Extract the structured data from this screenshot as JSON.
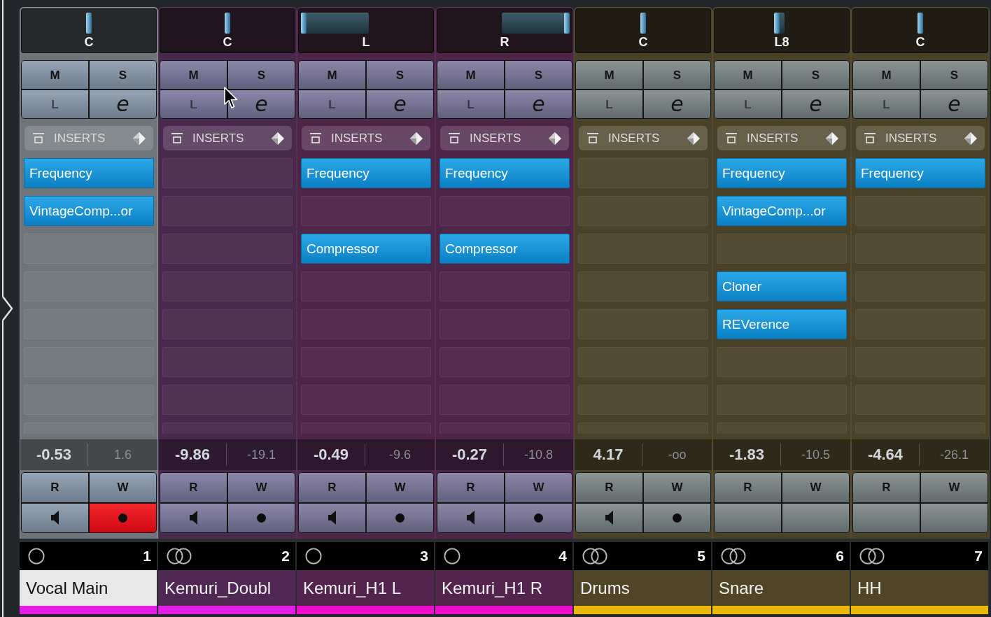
{
  "channels": [
    {
      "pan": {
        "label": "C",
        "level": 0.5
      },
      "buttons": [
        {
          "kind": "text",
          "label": "M",
          "disabled": false
        },
        {
          "kind": "text",
          "label": "S",
          "disabled": false
        },
        {
          "kind": "text",
          "label": "L",
          "disabled": true
        },
        {
          "kind": "edit",
          "label": "e",
          "disabled": false
        }
      ],
      "inserts": {
        "title": "INSERTS",
        "slots": [
          {
            "kind": "plugin",
            "name": "Frequency"
          },
          {
            "kind": "plugin",
            "name": "VintageComp...or"
          },
          {
            "kind": "empty"
          },
          {
            "kind": "empty"
          },
          {
            "kind": "empty"
          },
          {
            "kind": "empty"
          },
          {
            "kind": "empty"
          },
          {
            "kind": "empty"
          }
        ]
      },
      "volume": "-0.53",
      "peak": "1.6",
      "automation": [
        {
          "kind": "text",
          "label": "R"
        },
        {
          "kind": "text",
          "label": "W"
        },
        {
          "kind": "monitor",
          "on": false
        },
        {
          "kind": "record",
          "on": true
        }
      ],
      "kind": "mono",
      "number": "1",
      "name": "Vocal Main",
      "selected": true,
      "color": "#e21ee6"
    },
    {
      "pan": {
        "label": "C",
        "level": 0.5
      },
      "buttons": [
        {
          "kind": "text",
          "label": "M",
          "disabled": false
        },
        {
          "kind": "text",
          "label": "S",
          "disabled": false
        },
        {
          "kind": "text",
          "label": "L",
          "disabled": true
        },
        {
          "kind": "edit",
          "label": "e",
          "disabled": false
        }
      ],
      "inserts": {
        "title": "INSERTS",
        "slots": [
          {
            "kind": "empty"
          },
          {
            "kind": "empty"
          },
          {
            "kind": "empty"
          },
          {
            "kind": "empty"
          },
          {
            "kind": "empty"
          },
          {
            "kind": "empty"
          },
          {
            "kind": "empty"
          },
          {
            "kind": "empty"
          }
        ]
      },
      "volume": "-9.86",
      "peak": "-19.1",
      "automation": [
        {
          "kind": "text",
          "label": "R"
        },
        {
          "kind": "text",
          "label": "W"
        },
        {
          "kind": "monitor",
          "on": false
        },
        {
          "kind": "record",
          "on": false
        }
      ],
      "kind": "stereo",
      "number": "2",
      "name": "Kemuri_Doubl",
      "selected": false,
      "color": "#e21ee6"
    },
    {
      "pan": {
        "label": "L",
        "level": 0
      },
      "buttons": [
        {
          "kind": "text",
          "label": "M",
          "disabled": false
        },
        {
          "kind": "text",
          "label": "S",
          "disabled": false
        },
        {
          "kind": "text",
          "label": "L",
          "disabled": true
        },
        {
          "kind": "edit",
          "label": "e",
          "disabled": false
        }
      ],
      "inserts": {
        "title": "INSERTS",
        "slots": [
          {
            "kind": "plugin",
            "name": "Frequency"
          },
          {
            "kind": "empty"
          },
          {
            "kind": "plugin",
            "name": "Compressor"
          },
          {
            "kind": "empty"
          },
          {
            "kind": "empty"
          },
          {
            "kind": "empty"
          },
          {
            "kind": "empty"
          },
          {
            "kind": "empty"
          }
        ]
      },
      "volume": "-0.49",
      "peak": "-9.6",
      "automation": [
        {
          "kind": "text",
          "label": "R"
        },
        {
          "kind": "text",
          "label": "W"
        },
        {
          "kind": "monitor",
          "on": false
        },
        {
          "kind": "record",
          "on": false
        }
      ],
      "kind": "mono",
      "number": "3",
      "name": "Kemuri_H1 L",
      "selected": false,
      "color": "#f00ccc"
    },
    {
      "pan": {
        "label": "R",
        "level": 1
      },
      "buttons": [
        {
          "kind": "text",
          "label": "M",
          "disabled": false
        },
        {
          "kind": "text",
          "label": "S",
          "disabled": false
        },
        {
          "kind": "text",
          "label": "L",
          "disabled": true
        },
        {
          "kind": "edit",
          "label": "e",
          "disabled": false
        }
      ],
      "inserts": {
        "title": "INSERTS",
        "slots": [
          {
            "kind": "plugin",
            "name": "Frequency"
          },
          {
            "kind": "empty"
          },
          {
            "kind": "plugin",
            "name": "Compressor"
          },
          {
            "kind": "empty"
          },
          {
            "kind": "empty"
          },
          {
            "kind": "empty"
          },
          {
            "kind": "empty"
          },
          {
            "kind": "empty"
          }
        ]
      },
      "volume": "-0.27",
      "peak": "-10.8",
      "automation": [
        {
          "kind": "text",
          "label": "R"
        },
        {
          "kind": "text",
          "label": "W"
        },
        {
          "kind": "monitor",
          "on": false
        },
        {
          "kind": "record",
          "on": false
        }
      ],
      "kind": "mono",
      "number": "4",
      "name": "Kemuri_H1 R",
      "selected": false,
      "color": "#f00ccc"
    },
    {
      "pan": {
        "label": "C",
        "level": 0.5
      },
      "buttons": [
        {
          "kind": "text",
          "label": "M",
          "disabled": false
        },
        {
          "kind": "text",
          "label": "S",
          "disabled": false
        },
        {
          "kind": "text",
          "label": "L",
          "disabled": true
        },
        {
          "kind": "edit",
          "label": "e",
          "disabled": false
        }
      ],
      "inserts": {
        "title": "INSERTS",
        "slots": [
          {
            "kind": "empty"
          },
          {
            "kind": "empty"
          },
          {
            "kind": "empty"
          },
          {
            "kind": "empty"
          },
          {
            "kind": "empty"
          },
          {
            "kind": "empty"
          },
          {
            "kind": "empty"
          },
          {
            "kind": "empty"
          }
        ]
      },
      "volume": "4.17",
      "peak": "-oo",
      "automation": [
        {
          "kind": "text",
          "label": "R"
        },
        {
          "kind": "text",
          "label": "W"
        },
        {
          "kind": "monitor",
          "on": false
        },
        {
          "kind": "record",
          "on": false
        }
      ],
      "kind": "stereo",
      "number": "5",
      "name": "Drums",
      "selected": false,
      "color": "#e8b80c"
    },
    {
      "pan": {
        "label": "L8",
        "level": 0.46
      },
      "buttons": [
        {
          "kind": "text",
          "label": "M",
          "disabled": false
        },
        {
          "kind": "text",
          "label": "S",
          "disabled": false
        },
        {
          "kind": "text",
          "label": "L",
          "disabled": true
        },
        {
          "kind": "edit",
          "label": "e",
          "disabled": false
        }
      ],
      "inserts": {
        "title": "INSERTS",
        "slots": [
          {
            "kind": "plugin",
            "name": "Frequency"
          },
          {
            "kind": "plugin",
            "name": "VintageComp...or"
          },
          {
            "kind": "empty"
          },
          {
            "kind": "plugin",
            "name": "Cloner"
          },
          {
            "kind": "plugin",
            "name": "REVerence"
          },
          {
            "kind": "empty"
          },
          {
            "kind": "empty"
          },
          {
            "kind": "empty"
          }
        ]
      },
      "volume": "-1.83",
      "peak": "-10.5",
      "automation": [
        {
          "kind": "text",
          "label": "R"
        },
        {
          "kind": "text",
          "label": "W"
        },
        {
          "kind": "blank"
        },
        {
          "kind": "blank"
        }
      ],
      "kind": "stereo",
      "number": "6",
      "name": "Snare",
      "selected": false,
      "color": "#e8b80c"
    },
    {
      "pan": {
        "label": "C",
        "level": 0.5
      },
      "buttons": [
        {
          "kind": "text",
          "label": "M",
          "disabled": false
        },
        {
          "kind": "text",
          "label": "S",
          "disabled": false
        },
        {
          "kind": "text",
          "label": "L",
          "disabled": true
        },
        {
          "kind": "edit",
          "label": "e",
          "disabled": false
        }
      ],
      "inserts": {
        "title": "INSERTS",
        "slots": [
          {
            "kind": "plugin",
            "name": "Frequency"
          },
          {
            "kind": "empty"
          },
          {
            "kind": "empty"
          },
          {
            "kind": "empty"
          },
          {
            "kind": "empty"
          },
          {
            "kind": "empty"
          },
          {
            "kind": "empty"
          },
          {
            "kind": "empty"
          }
        ]
      },
      "volume": "-4.64",
      "peak": "-26.1",
      "automation": [
        {
          "kind": "text",
          "label": "R"
        },
        {
          "kind": "text",
          "label": "W"
        },
        {
          "kind": "blank"
        },
        {
          "kind": "blank"
        }
      ],
      "kind": "stereo",
      "number": "7",
      "name": "HH",
      "selected": false,
      "color": "#e8b80c"
    }
  ]
}
